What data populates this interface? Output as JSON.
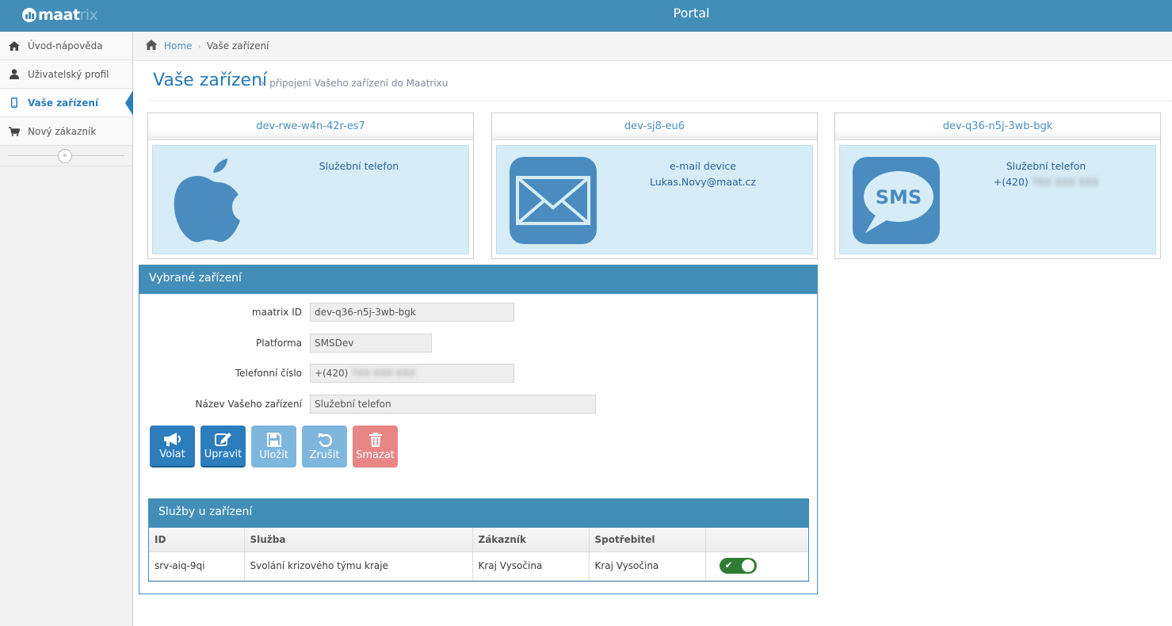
{
  "app": {
    "logo_text": "maat",
    "logo_text_faded": "rix",
    "title": "Portal"
  },
  "sidebar": {
    "items": [
      {
        "label": "Úvod-nápověda",
        "icon": "home-icon"
      },
      {
        "label": "Uživatelský profil",
        "icon": "user-icon"
      },
      {
        "label": "Vaše zařízení",
        "icon": "mobile-icon",
        "active": true
      },
      {
        "label": "Nový zákazník",
        "icon": "cart-icon"
      }
    ],
    "collapse_symbol": "«"
  },
  "breadcrumb": {
    "home": "Home",
    "separator": "›",
    "current": "Vaše zařízení"
  },
  "page": {
    "title": "Vaše zařízení",
    "subtitle": "» připojení Vašeho zařízení do Maatrixu"
  },
  "devices": [
    {
      "id": "dev-rwe-w4n-42r-es7",
      "icon": "apple-icon",
      "line1": "Služební telefon",
      "line2": ""
    },
    {
      "id": "dev-sj8-eu6",
      "icon": "envelope-icon",
      "line1": "e-mail device",
      "line2": "Lukas.Novy@maat.cz"
    },
    {
      "id": "dev-q36-n5j-3wb-bgk",
      "icon": "sms-icon",
      "line1": "Služební telefon",
      "line2_prefix": "+(420)",
      "line2_blurred": "7XX XXX XXX",
      "sms_label": "SMS"
    }
  ],
  "selected": {
    "title": "Vybrané zařízení",
    "fields": {
      "maatrix_id": {
        "label": "maatrix ID",
        "value": "dev-q36-n5j-3wb-bgk"
      },
      "platform": {
        "label": "Platforma",
        "value": "SMSDev"
      },
      "phone": {
        "label": "Telefonní číslo",
        "prefix": "+(420)",
        "blurred": "7XX XXX XXX"
      },
      "name": {
        "label": "Název Vašeho zařízení",
        "value": "Služební telefon"
      }
    },
    "buttons": {
      "call": "Volat",
      "edit": "Upravit",
      "save": "Uložit",
      "cancel": "Zrušit",
      "delete": "Smazat"
    }
  },
  "services": {
    "title": "Služby u zařízení",
    "columns": [
      "ID",
      "Služba",
      "Zákazník",
      "Spotřebitel",
      ""
    ],
    "rows": [
      {
        "id": "srv-aiq-9qi",
        "service": "Svolání krizového týmu kraje",
        "customer": "Kraj Vysočina",
        "consumer": "Kraj Vysočina",
        "enabled": true,
        "toggle_mark": "✔"
      }
    ]
  },
  "colors": {
    "header_blue": "#438eb9",
    "accent": "#2b7dbc",
    "card_bg": "#d6ecf7",
    "toggle_on": "#2e7d32",
    "danger": "#e88585"
  }
}
